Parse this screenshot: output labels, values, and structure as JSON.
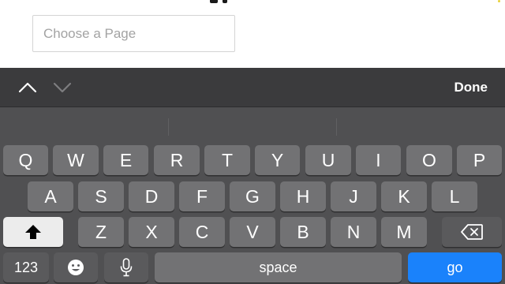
{
  "page": {
    "input_placeholder": "Choose a Page",
    "input_value": ""
  },
  "accessory_bar": {
    "prev_icon": "chevron-up-icon",
    "next_icon": "chevron-down-icon",
    "done_label": "Done"
  },
  "keyboard": {
    "row1": [
      "Q",
      "W",
      "E",
      "R",
      "T",
      "Y",
      "U",
      "I",
      "O",
      "P"
    ],
    "row2": [
      "A",
      "S",
      "D",
      "F",
      "G",
      "H",
      "J",
      "K",
      "L"
    ],
    "row3": [
      "Z",
      "X",
      "C",
      "V",
      "B",
      "N",
      "M"
    ],
    "shift_icon": "shift-icon",
    "backspace_icon": "backspace-icon",
    "numbers_label": "123",
    "emoji_icon": "emoji-icon",
    "mic_icon": "microphone-icon",
    "space_label": "space",
    "go_label": "go",
    "colors": {
      "key": "#727274",
      "function_key": "#5a5a5c",
      "go_key": "#1a82fb",
      "background": "#505052"
    }
  }
}
